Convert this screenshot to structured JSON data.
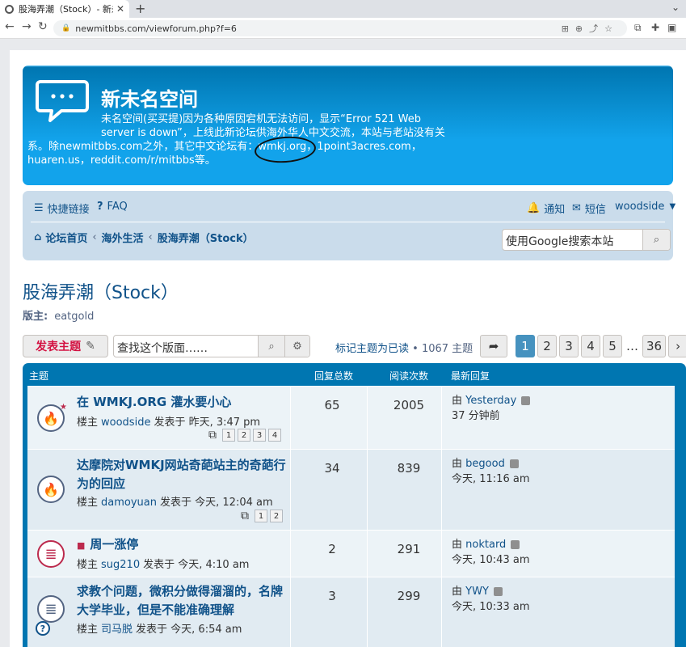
{
  "browser": {
    "tab_title": "股海弄潮（Stock）- 新未",
    "url": "newmitbbs.com/viewforum.php?f=6"
  },
  "header": {
    "site_title": "新未名空间",
    "desc_line1": "未名空间(买买提)因为各种原因宕机无法访问，显示“Error 521 Web",
    "desc_line2": "server is down”，上线此新论坛供海外华人中文交流，本站与老站没有关",
    "desc_line3": "系。除newmitbbs.com之外，其它中文论坛有：wmkj.org，1point3acres.com，",
    "desc_line4": "huaren.us，reddit.com/r/mitbbs等。"
  },
  "navbar": {
    "quicklinks": "快捷链接",
    "faq": "FAQ",
    "notify": "通知",
    "pm": "短信",
    "user": "woodside",
    "crumbs": [
      "论坛首页",
      "海外生活",
      "股海弄潮（Stock）"
    ],
    "search_placeholder": "使用Google搜索本站"
  },
  "forum": {
    "title": "股海弄潮（Stock）",
    "moderator_label": "版主:",
    "moderator": "eatgold",
    "new_topic": "发表主题",
    "search_placeholder": "查找这个版面……",
    "mark_read": "标记主题为已读",
    "topic_count": "• 1067 主题",
    "pages": [
      "1",
      "2",
      "3",
      "4",
      "5",
      "…",
      "36"
    ]
  },
  "table": {
    "headers": [
      "主题",
      "回复总数",
      "阅读次数",
      "最新回复"
    ],
    "rows": [
      {
        "title": "在 WMKJ.ORG 灌水要小心",
        "by": "楼主",
        "author": "woodside",
        "posted": "发表于 昨天, 3:47 pm",
        "pages": [
          "1",
          "2",
          "3",
          "4"
        ],
        "replies": "65",
        "views": "2005",
        "last_by": "由",
        "last_user": "Yesterday",
        "last_time": "37 分钟前"
      },
      {
        "title": "达摩院对WMKJ网站奇葩站主的奇葩行为的回应",
        "title_l1": "达摩院对WMKJ网站奇葩站主的奇葩行",
        "title_l2": "为的回应",
        "by": "楼主",
        "author": "damoyuan",
        "posted": "发表于 今天, 12:04 am",
        "pages": [
          "1",
          "2"
        ],
        "replies": "34",
        "views": "839",
        "last_by": "由",
        "last_user": "begood",
        "last_time": "今天, 11:16 am"
      },
      {
        "title": "周一涨停",
        "by": "楼主",
        "author": "sug210",
        "posted": "发表于 今天, 4:10 am",
        "replies": "2",
        "views": "291",
        "last_by": "由",
        "last_user": "noktard",
        "last_time": "今天, 10:43 am"
      },
      {
        "title_l1": "求教个问题，微积分做得溜溜的，名牌",
        "title_l2": "大学毕业，但是不能准确理解",
        "by": "楼主",
        "author": "司马脱",
        "posted": "发表于 今天, 6:54 am",
        "replies": "3",
        "views": "299",
        "last_by": "由",
        "last_user": "YWY",
        "last_time": "今天, 10:33 am"
      }
    ]
  },
  "colors": {
    "header_blue": "#12a3eb",
    "link": "#105289",
    "newtopic_red": "#d31141"
  }
}
